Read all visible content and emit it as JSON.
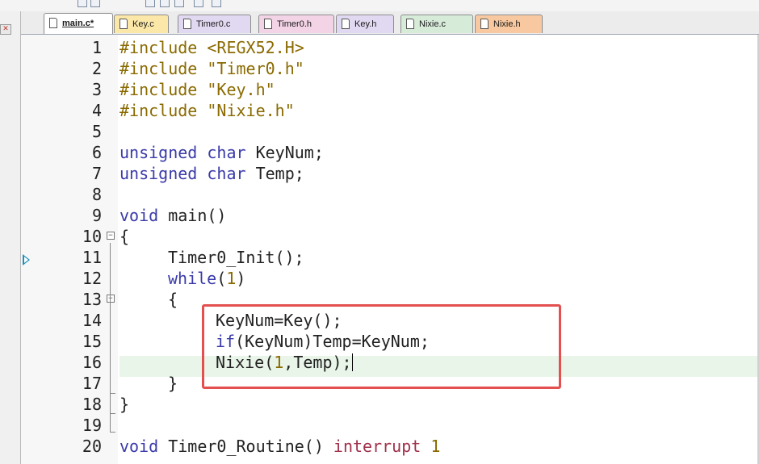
{
  "tabs": [
    {
      "label": "main.c*",
      "kind": "active"
    },
    {
      "label": "Key.c",
      "kind": "c-file"
    },
    {
      "label": "Timer0.c",
      "kind": "h-file2"
    },
    {
      "label": "Timer0.h",
      "kind": "h-file"
    },
    {
      "label": "Key.h",
      "kind": "h-file2"
    },
    {
      "label": "Nixie.c",
      "kind": "c-file2"
    },
    {
      "label": "Nixie.h",
      "kind": "h-file3"
    }
  ],
  "line_numbers": [
    "1",
    "2",
    "3",
    "4",
    "5",
    "6",
    "7",
    "8",
    "9",
    "10",
    "11",
    "12",
    "13",
    "14",
    "15",
    "16",
    "17",
    "18",
    "19",
    "20"
  ],
  "code": {
    "l1_directive": "#include",
    "l1_arg": "<REGX52.H>",
    "l2_directive": "#include",
    "l2_arg": "\"Timer0.h\"",
    "l3_directive": "#include",
    "l3_arg": "\"Key.h\"",
    "l4_directive": "#include",
    "l4_arg": "\"Nixie.h\"",
    "l6_kw1": "unsigned",
    "l6_kw2": "char",
    "l6_rest": "KeyNum;",
    "l7_kw1": "unsigned",
    "l7_kw2": "char",
    "l7_rest": "Temp;",
    "l9_kw": "void",
    "l9_rest": "main()",
    "l10": "{",
    "l11": "Timer0_Init();",
    "l12_kw": "while",
    "l12_open": "(",
    "l12_num": "1",
    "l12_close": ")",
    "l13": "{",
    "l14": "KeyNum=Key();",
    "l15_kw": "if",
    "l15_rest": "(KeyNum)Temp=KeyNum;",
    "l16_a": "Nixie(",
    "l16_num": "1",
    "l16_b": ",Temp);",
    "l17": "}",
    "l18": "}",
    "l20_kw": "void",
    "l20_mid": "Timer0_Routine()",
    "l20_kw2": "interrupt",
    "l20_num": "1"
  },
  "colors": {
    "keyword": "#3a3aaa",
    "preprocessor": "#8a6a00",
    "highlight_box": "#e45050",
    "current_line": "#e8f5e8"
  }
}
